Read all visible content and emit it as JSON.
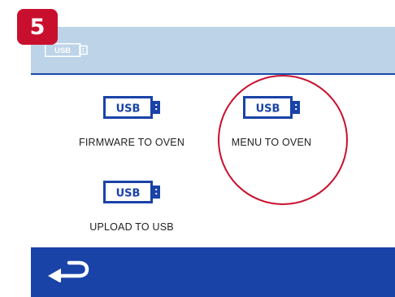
{
  "step": {
    "number": "5"
  },
  "header": {
    "icon_label": "USB",
    "icon": "usb-drive-icon"
  },
  "tiles": [
    {
      "label": "FIRMWARE TO OVEN",
      "icon_label": "USB"
    },
    {
      "label": "MENU TO OVEN",
      "icon_label": "USB"
    },
    {
      "label": "UPLOAD TO USB",
      "icon_label": "USB"
    }
  ],
  "footer": {
    "back_icon": "back-arrow-icon"
  },
  "colors": {
    "accent": "#c8102e",
    "header_bg": "#bdd3e8",
    "footer_bg": "#1a43a8",
    "usb_blue": "#1a43a8"
  }
}
